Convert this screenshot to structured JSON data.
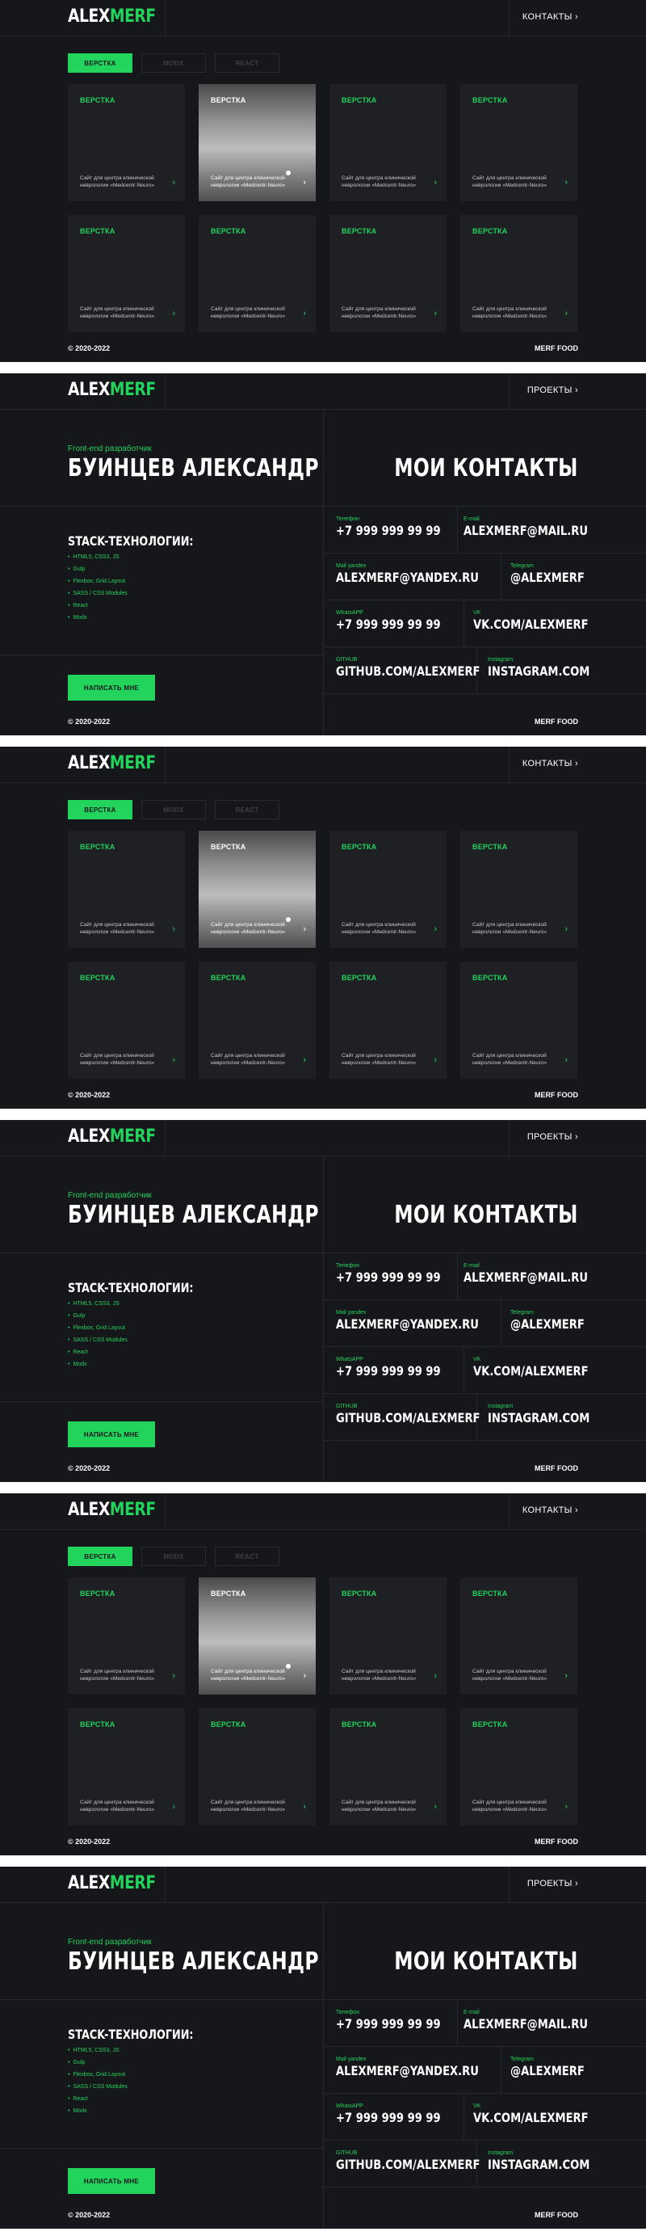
{
  "logo": {
    "part1": "ALEX",
    "part2": "MERF"
  },
  "projects_page": {
    "nav_label": "КОНТАКТЫ",
    "nav_icon": "chevron-right-icon",
    "tabs": [
      {
        "label": "ВЕРСТКА",
        "active": true
      },
      {
        "label": "MODX",
        "active": false
      },
      {
        "label": "REACT",
        "active": false
      }
    ],
    "cards": [
      {
        "title": "ВЕРСТКА",
        "desc_line1": "Сайт для центра клинической",
        "desc_line2": "неврологии «Medcentr-Neuro»",
        "photo": false
      },
      {
        "title": "ВЕРСТКА",
        "desc_line1": "Сайт для центра клинической",
        "desc_line2": "неврологии «Medcentr-Neuro»",
        "photo": true
      },
      {
        "title": "ВЕРСТКА",
        "desc_line1": "Сайт для центра клинической",
        "desc_line2": "неврологии «Medcentr-Neuro»",
        "photo": false
      },
      {
        "title": "ВЕРСТКА",
        "desc_line1": "Сайт для центра клинической",
        "desc_line2": "неврологии «Medcentr-Neuro»",
        "photo": false
      },
      {
        "title": "ВЕРСТКА",
        "desc_line1": "Сайт для центра клинической",
        "desc_line2": "неврологии «Medcentr-Neuro»",
        "photo": false
      },
      {
        "title": "ВЕРСТКА",
        "desc_line1": "Сайт для центра клинической",
        "desc_line2": "неврологии «Medcentr-Neuro»",
        "photo": false
      },
      {
        "title": "ВЕРСТКА",
        "desc_line1": "Сайт для центра клинической",
        "desc_line2": "неврологии «Medcentr-Neuro»",
        "photo": false
      },
      {
        "title": "ВЕРСТКА",
        "desc_line1": "Сайт для центра клинической",
        "desc_line2": "неврологии «Medcentr-Neuro»",
        "photo": false
      }
    ],
    "arrow_glyph": "›"
  },
  "contacts_page": {
    "nav_label": "ПРОЕКТЫ",
    "role": "Front-end разработчик",
    "name": "БУИНЦЕВ АЛЕКСАНДР",
    "contacts_title": "МОИ КОНТАКТЫ",
    "stack_title": "STACK-ТЕХНОЛОГИИ:",
    "stack_items": [
      "HTML5, CSS3, JS",
      "Gulp",
      "Flexbox, Grid Layout",
      "SASS / CSS Modules",
      "React",
      "Modx"
    ],
    "write_button": "НАПИСАТЬ МНЕ",
    "contacts": {
      "phone": {
        "label": "Телефон",
        "value": "+7 999 999 99 99"
      },
      "email": {
        "label": "E-mail",
        "value": "ALEXMERF@MAIL.RU"
      },
      "yandex": {
        "label": "Mail yandex",
        "value": "ALEXMERF@YANDEX.RU"
      },
      "telegram": {
        "label": "Telegram",
        "value": "@ALEXMERF"
      },
      "whatsapp": {
        "label": "WhatsAPP",
        "value": "+7 999 999 99 99"
      },
      "vk": {
        "label": "VK",
        "value": "VK.COM/ALEXMERF"
      },
      "github": {
        "label": "GITHUB",
        "value": "GITHUB.COM/ALEXMERF"
      },
      "instagram": {
        "label": "Instagram",
        "value": "INSTAGRAM.COM"
      }
    }
  },
  "footer": {
    "copyright": "© 2020-2022",
    "brand": "MERF FOOD"
  },
  "colors": {
    "accent": "#22d35c",
    "background": "#16171b",
    "card": "#1f2024"
  }
}
